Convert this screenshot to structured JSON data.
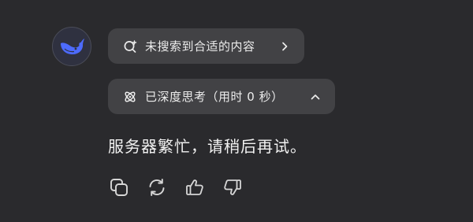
{
  "assistant": {
    "avatar_icon": "whale-logo-icon",
    "accent_color": "#4d6bfe"
  },
  "search_chip": {
    "icon": "search-sparkle-icon",
    "label": "未搜索到合适的内容",
    "trailing_icon": "chevron-right-icon"
  },
  "thinking_chip": {
    "icon": "atom-icon",
    "label": "已深度思考（用时 0 秒）",
    "trailing_icon": "chevron-up-icon"
  },
  "message": {
    "text": "服务器繁忙，请稍后再试。"
  },
  "actions": [
    {
      "name": "copy",
      "icon": "copy-icon"
    },
    {
      "name": "regenerate",
      "icon": "refresh-icon"
    },
    {
      "name": "like",
      "icon": "thumbs-up-icon"
    },
    {
      "name": "dislike",
      "icon": "thumbs-down-icon"
    }
  ]
}
